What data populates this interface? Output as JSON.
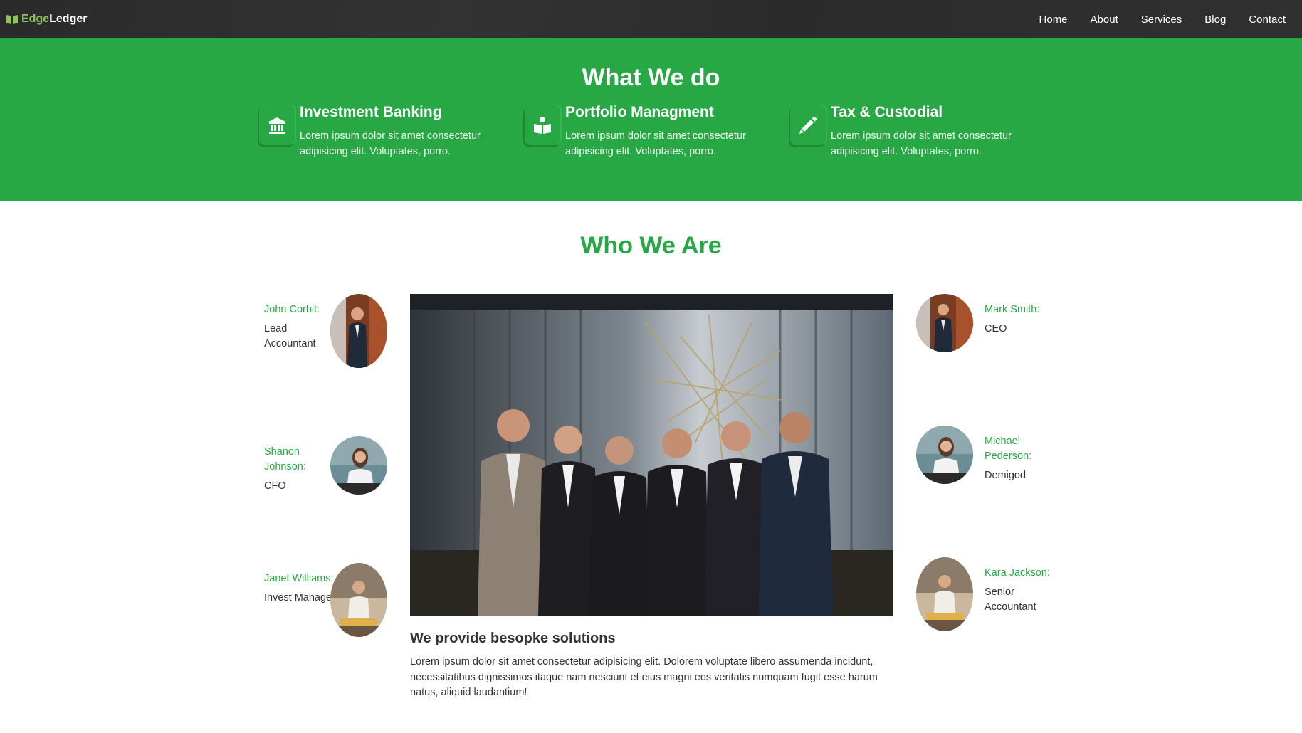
{
  "brand": {
    "part1": "Edge",
    "part2": "Ledger",
    "icon": "book-icon"
  },
  "nav": [
    "Home",
    "About",
    "Services",
    "Blog",
    "Contact"
  ],
  "what_we_do": {
    "title": "What We do",
    "services": [
      {
        "icon": "bank-icon",
        "title": "Investment Banking",
        "desc": "Lorem ipsum dolor sit amet consectetur adipisicing elit. Voluptates, porro."
      },
      {
        "icon": "open-book-user-icon",
        "title": "Portfolio Managment",
        "desc": "Lorem ipsum dolor sit amet consectetur adipisicing elit. Voluptates, porro."
      },
      {
        "icon": "pencil-icon",
        "title": "Tax & Custodial",
        "desc": "Lorem ipsum dolor sit amet consectetur adipisicing elit. Voluptates, porro."
      }
    ]
  },
  "who_we_are": {
    "title": "Who We Are",
    "left": [
      {
        "name": "John Corbit:",
        "role": "Lead Accountant"
      },
      {
        "name": "Shanon Johnson:",
        "role": "CFO"
      },
      {
        "name": "Janet Williams:",
        "role": "Invest Manager"
      }
    ],
    "right": [
      {
        "name": "Mark Smith:",
        "role": "CEO"
      },
      {
        "name": "Michael Pederson:",
        "role": "Demigod"
      },
      {
        "name": "Kara Jackson:",
        "role": "Senior Accountant"
      }
    ],
    "solutions_title": "We provide besopke solutions",
    "solutions_text": "Lorem ipsum dolor sit amet consectetur adipisicing elit. Dolorem voluptate libero assumenda incidunt, necessitatibus dignissimos itaque nam nesciunt et eius magni eos veritatis numquam fugit esse harum natus, aliquid laudantium!"
  },
  "colors": {
    "accent": "#27a844",
    "nav_bg": "#2d2d2d",
    "brand_accent": "#8fc25b"
  }
}
